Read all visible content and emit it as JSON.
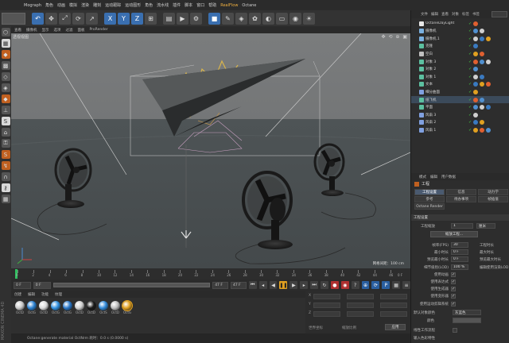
{
  "menubar": {
    "items": [
      "Mograph",
      "角色",
      "动画",
      "模拟",
      "渲染",
      "雕刻",
      "运动跟踪",
      "运动图形",
      "角色",
      "流水线",
      "插件",
      "脚本",
      "窗口",
      "帮助",
      "RealFlow",
      "Octane"
    ],
    "highlight_index": 14
  },
  "viewport": {
    "menu": [
      "查看",
      "摄像机",
      "显示",
      "选项",
      "过滤",
      "面板",
      "ProRender"
    ],
    "label": "透视视图",
    "scale": "网格间距：100 cm",
    "nav": "✥ ⟲ ⊕ ▣"
  },
  "timeline": {
    "ticks": [
      "0",
      "2",
      "4",
      "6",
      "8",
      "10",
      "12",
      "14",
      "16",
      "18",
      "20",
      "22",
      "24",
      "26",
      "28",
      "30",
      "32",
      "34",
      "36",
      "38",
      "40",
      "42",
      "44",
      "46"
    ],
    "end_label": "0 F"
  },
  "transport": {
    "frame_start": "0 F",
    "frame_cur": "0 F",
    "frame_end": "47 F",
    "frame_end2": "47 F"
  },
  "material": {
    "menu": [
      "创建",
      "编辑",
      "功能",
      "纹理"
    ],
    "items": [
      {
        "label": "OctD",
        "color": "#c9c9c9"
      },
      {
        "label": "OctG",
        "color": "#2a80d0"
      },
      {
        "label": "OctD",
        "color": "#dadada"
      },
      {
        "label": "OctG",
        "color": "#3090e0"
      },
      {
        "label": "OctG",
        "color": "#2876c8"
      },
      {
        "label": "OctD",
        "color": "#cfcfcf"
      },
      {
        "label": "OctD",
        "color": "#1a1a1a"
      },
      {
        "label": "OctS",
        "color": "#2f88d8"
      },
      {
        "label": "OctD",
        "color": "#bdbdbd"
      },
      {
        "label": "OctG",
        "color": "#e0a020"
      }
    ]
  },
  "coord": {
    "rows": [
      "X",
      "Y",
      "Z"
    ],
    "apply": "应用",
    "world": "世界坐标",
    "scale": "缩放比例"
  },
  "status": "Octane:generate material OctNrm    耗时：0.0 s (0.0000 s)",
  "vertical_text": "MAXON CINEMA 4D",
  "objects": {
    "menu": [
      "文件",
      "编辑",
      "查看",
      "对象",
      "标签",
      "书签"
    ],
    "rows": [
      {
        "name": "OctaneDayLight",
        "color": "#e8e8e8"
      },
      {
        "name": "摄像机",
        "color": "#7ab0e0"
      },
      {
        "name": "摄像机.1",
        "color": "#7ab0e0"
      },
      {
        "name": "克隆",
        "color": "#5cc0a0"
      },
      {
        "name": "空白",
        "color": "#c0c0c0"
      },
      {
        "name": "对象 3",
        "color": "#5cc0a0"
      },
      {
        "name": "对象 2",
        "color": "#5cc0a0"
      },
      {
        "name": "对象 1",
        "color": "#5cc0a0"
      },
      {
        "name": "文本",
        "color": "#5cc0a0"
      },
      {
        "name": "细分曲面",
        "color": "#80a0e0"
      },
      {
        "name": "纸飞机",
        "color": "#5cc0a0"
      },
      {
        "name": "平面",
        "color": "#5cc0a0"
      },
      {
        "name": "风扇 3",
        "color": "#80a0e0"
      },
      {
        "name": "风扇 2",
        "color": "#80a0e0"
      },
      {
        "name": "风扇 1",
        "color": "#80a0e0"
      }
    ]
  },
  "attr": {
    "menu": [
      "模式",
      "编辑",
      "用户数据"
    ],
    "header": "工程",
    "tabs": [
      "工程设置",
      "信息",
      "动力学",
      "参考",
      "待办事项",
      "帧插值"
    ],
    "tab3": "Octane Render",
    "section": "工程设置",
    "scale_label": "工程缩放",
    "scale_val": "1",
    "scale_unit": "厘米",
    "scale_btn": "缩放工程...",
    "fields": [
      {
        "label": "帧率(FPS)",
        "val": "30"
      },
      {
        "label": "最小时长",
        "val": "0 F"
      },
      {
        "label": "预览最小时长",
        "val": "0 F"
      },
      {
        "label": "细节级别(LOD)",
        "val": "100 %"
      },
      {
        "label": "使用动画",
        "val": "✓"
      },
      {
        "label": "使用表达式",
        "val": "✓"
      },
      {
        "label": "使用生成器",
        "val": "✓"
      },
      {
        "label": "使用变形器",
        "val": "✓"
      },
      {
        "label": "使用运动剪辑系统",
        "val": "✓"
      }
    ],
    "right_labels": [
      "工程时长",
      "最大时长",
      "预览最大时长",
      "编辑使用渲染LOD"
    ],
    "right_vals": [
      "47 F",
      "47 F",
      "47 F",
      ""
    ],
    "color_label": "默认对象颜色",
    "color_val": "灰蓝色",
    "color2": "颜色",
    "linear": "线性工作流程",
    "input": "输入色彩特性"
  }
}
